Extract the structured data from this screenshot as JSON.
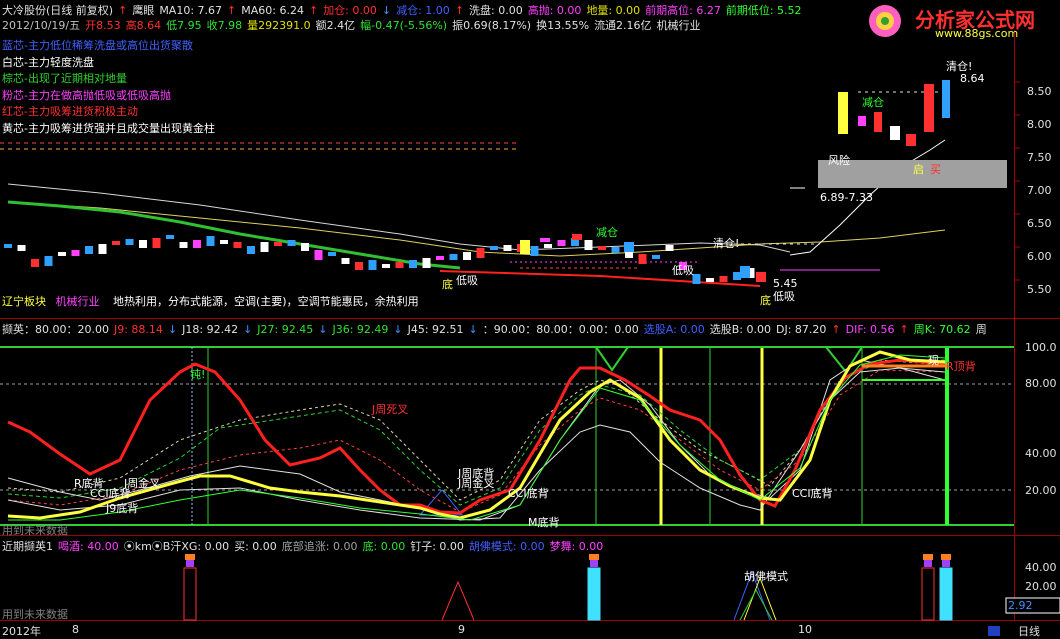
{
  "header": {
    "line1": [
      {
        "text": "大冷股份(日线 前复权)",
        "color": "#e0e0e0"
      },
      {
        "text": "↑",
        "color": "#ff3030"
      },
      {
        "text": "鹰眼",
        "color": "#e0e0e0"
      },
      {
        "text": "MA10: 7.67",
        "color": "#e0e0e0"
      },
      {
        "text": "↑",
        "color": "#ff3030"
      },
      {
        "text": "MA60: 6.24",
        "color": "#e0e0e0"
      },
      {
        "text": "↑",
        "color": "#ff3030"
      },
      {
        "text": "加仓: 0.00",
        "color": "#ff3030"
      },
      {
        "text": "↓",
        "color": "#4090ff"
      },
      {
        "text": "减仓: 1.00",
        "color": "#4060ff"
      },
      {
        "text": "↑",
        "color": "#ff3030"
      },
      {
        "text": "洗盘: 0.00",
        "color": "#e0e0e0"
      },
      {
        "text": "高抛: 0.00",
        "color": "#ff40ff"
      },
      {
        "text": "地量: 0.00",
        "color": "#e0e000"
      },
      {
        "text": "前期高位: 6.27",
        "color": "#ff40ff"
      },
      {
        "text": "前期低位: 5.52",
        "color": "#30ff30"
      }
    ],
    "line2": [
      {
        "text": "2012/10/19/五",
        "color": "#c0c0c0"
      },
      {
        "text": "开8.53",
        "color": "#ff3030"
      },
      {
        "text": "高8.64",
        "color": "#ff3030"
      },
      {
        "text": "低7.95",
        "color": "#30e030"
      },
      {
        "text": "收7.98",
        "color": "#30e030"
      },
      {
        "text": "量292391.0",
        "color": "#e0e000"
      },
      {
        "text": "额2.4亿",
        "color": "#e0e0e0"
      },
      {
        "text": "幅-0.47(-5.56%)",
        "color": "#30e030"
      },
      {
        "text": "振0.69(8.17%)",
        "color": "#e0e0e0"
      },
      {
        "text": "换13.55%",
        "color": "#e0e0e0"
      },
      {
        "text": "流通2.16亿",
        "color": "#e0e0e0"
      },
      {
        "text": "机械行业",
        "color": "#e0e0e0"
      }
    ]
  },
  "logo": {
    "title": "分析家公式网",
    "url": "www.88gs.com"
  },
  "legend": [
    {
      "text": "蓝芯-主力低位稀筹洗盘或高位出货聚散",
      "color": "#4060ff"
    },
    {
      "text": "白芯-主力轻度洗盘",
      "color": "#ffffff"
    },
    {
      "text": "棕芯-出现了近期相对地量",
      "color": "#30d030"
    },
    {
      "text": "粉芯-主力在做高抛低吸或低吸高抛",
      "color": "#ff40ff"
    },
    {
      "text": "红芯-主力吸筹进货积极主动",
      "color": "#ff3030"
    },
    {
      "text": "黄芯-主力吸筹进货强并且成交量出现黄金柱",
      "color": "#ffffff"
    }
  ],
  "price_axis": [
    "8.50",
    "8.00",
    "7.50",
    "7.00",
    "6.50",
    "6.00",
    "5.50"
  ],
  "main_labels": {
    "qingcang1": "清仓!",
    "high_price": "8.64",
    "jiancang": "减仓",
    "fengxian": "风险",
    "range": "6.89-7.33",
    "mai": "买",
    "jiancang2": "减仓",
    "qingcang2": "清仓!",
    "di1": "底",
    "dixi1": "低吸",
    "dixi2": "低吸",
    "jiao": "启",
    "low_price": "5.45",
    "di2": "底",
    "dixi3": "低吸"
  },
  "sector": {
    "a": "辽宁板块",
    "b": "机械行业",
    "c": "地热利用，分布式能源，空调(主要)，空调节能惠民，余热利用"
  },
  "ind1": {
    "header": [
      {
        "text": "撷英：80.00：20.00",
        "color": "#e0e0e0"
      },
      {
        "text": "J9: 88.14",
        "color": "#ff3030"
      },
      {
        "text": "↓",
        "color": "#4090ff"
      },
      {
        "text": "J18: 92.42",
        "color": "#e0e0e0"
      },
      {
        "text": "↓",
        "color": "#4090ff"
      },
      {
        "text": "J27: 92.45",
        "color": "#30e030"
      },
      {
        "text": "↓",
        "color": "#4090ff"
      },
      {
        "text": "J36: 92.49",
        "color": "#30e030"
      },
      {
        "text": "↓",
        "color": "#4090ff"
      },
      {
        "text": "J45: 92.51",
        "color": "#e0e0e0"
      },
      {
        "text": "↓",
        "color": "#4090ff"
      },
      {
        "text": "：90.00：80.00：0.00：0.00",
        "color": "#e0e0e0"
      },
      {
        "text": "选股A: 0.00",
        "color": "#4060ff"
      },
      {
        "text": "选股B: 0.00",
        "color": "#e0e0e0"
      },
      {
        "text": "DJ: 87.20",
        "color": "#e0e0e0"
      },
      {
        "text": "↑",
        "color": "#ff3030"
      },
      {
        "text": "DIF: 0.56",
        "color": "#ff40ff"
      },
      {
        "text": "↑",
        "color": "#ff3030"
      },
      {
        "text": "周K: 70.62",
        "color": "#30ff30"
      },
      {
        "text": "周",
        "color": "#e0e0e0"
      }
    ],
    "axis": [
      "100.0",
      "80.00",
      "40.00",
      "20.00"
    ],
    "labels": {
      "zhou1": "钝!",
      "jsi": "J周死叉",
      "rdb": "R底背",
      "jjc1": "J周金叉",
      "ccidb1": "CCI底背",
      "j9db": "J9底背",
      "jdb": "J周底背",
      "jjc2": "J周金叉",
      "ccidb2": "CCI底背",
      "mdb": "M底背",
      "ccidb3": "CCI底背",
      "xian": "现",
      "rdingbei": "R顶背",
      "future": "用到未来数据"
    }
  },
  "ind2": {
    "header": [
      {
        "text": "近期撷英1",
        "color": "#e0e0e0"
      },
      {
        "text": "喝酒: 40.00",
        "color": "#ff40ff"
      },
      {
        "text": "⦿km⦿B汗XG: 0.00",
        "color": "#e0e0e0"
      },
      {
        "text": "买: 0.00",
        "color": "#e0e0e0"
      },
      {
        "text": "底部追涨: 0.00",
        "color": "#a0a0a0"
      },
      {
        "text": "底: 0.00",
        "color": "#30e030"
      },
      {
        "text": "钉子: 0.00",
        "color": "#e0e0e0"
      },
      {
        "text": "胡佛模式: 0.00",
        "color": "#4060ff"
      },
      {
        "text": "梦舞: 0.00",
        "color": "#ff40ff"
      }
    ],
    "axis": [
      "40.00",
      "20.00"
    ],
    "value_box": "2.92",
    "hufo": "胡佛模式",
    "future": "用到未来数据"
  },
  "bottom": {
    "year": "2012年",
    "m8": "8",
    "m9": "9",
    "m10": "10",
    "period": "日线"
  }
}
